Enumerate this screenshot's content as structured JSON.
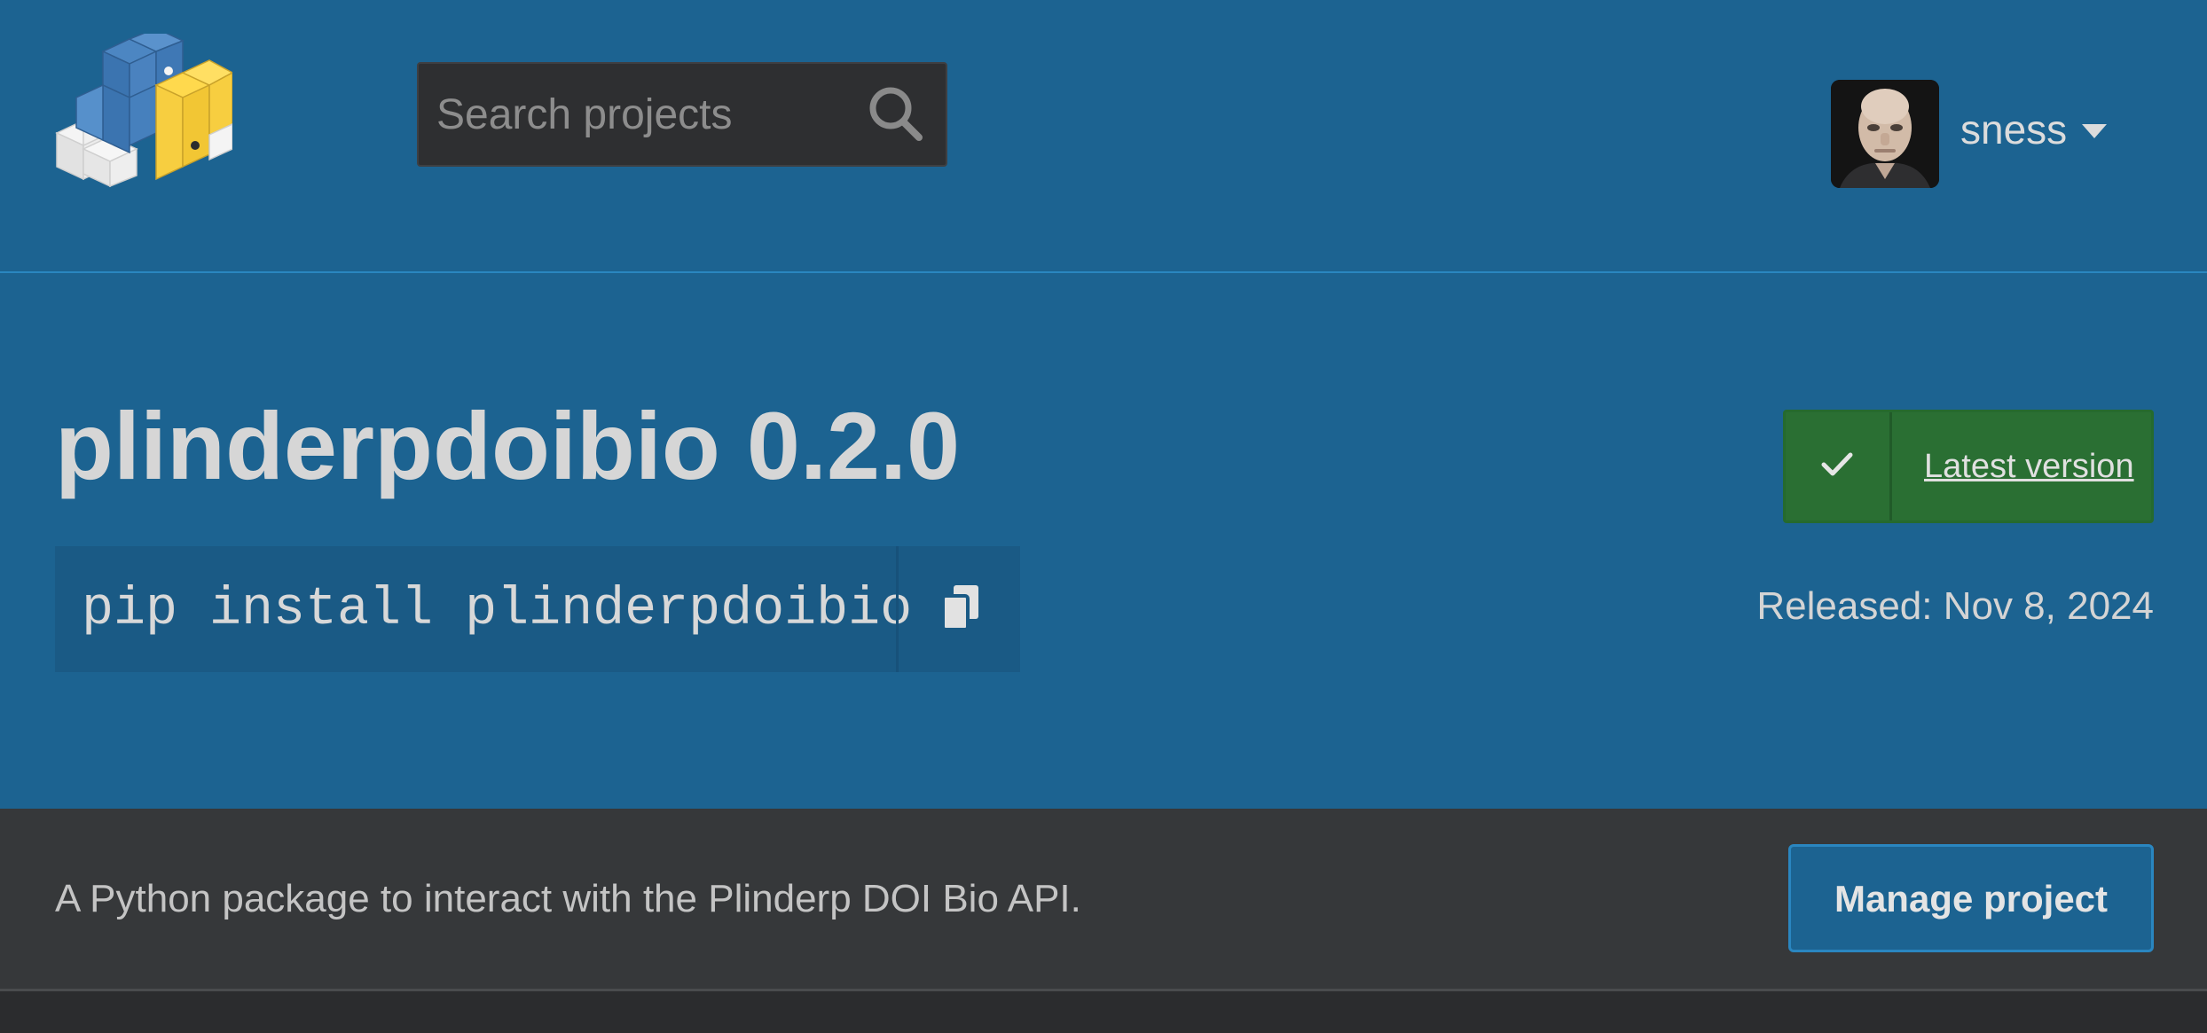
{
  "header": {
    "logo_icon": "pypi-logo-icon",
    "search": {
      "placeholder": "Search projects",
      "value": "",
      "icon": "search-icon"
    },
    "user": {
      "username": "sness",
      "avatar": "user-avatar",
      "caret_icon": "caret-down-icon"
    }
  },
  "hero": {
    "title": "plinderpdoibio 0.2.0",
    "pip_command": "pip install plinderpdoibio",
    "copy_icon": "copy-icon",
    "latest_badge": {
      "icon": "check-icon",
      "label": "Latest version"
    },
    "released": "Released: Nov 8, 2024"
  },
  "summary": {
    "description": "A Python package to interact with the Plinderp DOI Bio API.",
    "manage_label": "Manage project"
  },
  "colors": {
    "header_bg": "#1c6391",
    "summary_bg": "#36383a",
    "badge_green": "#2a6f33",
    "logo_yellow": "#f7ce40",
    "logo_blue": "#3b74b0"
  }
}
